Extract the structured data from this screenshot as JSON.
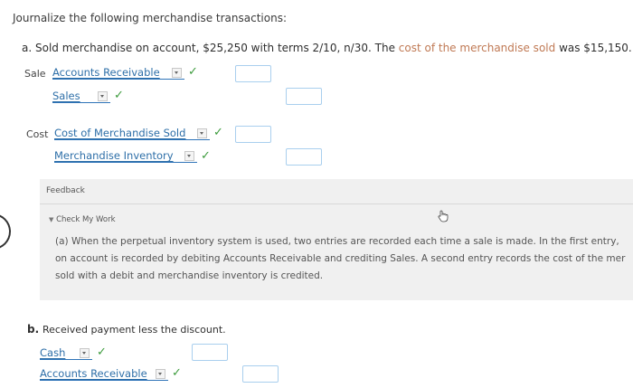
{
  "heading": "Journalize the following merchandise transactions:",
  "part_a": {
    "letter": "a.",
    "text_before": "Sold merchandise on account, $25,250 with terms 2/10, n/30. The",
    "text_highlight": "cost of the merchandise sold",
    "text_after": "was $15,150.",
    "sale_label": "Sale",
    "sale_debit": "Accounts Receivable",
    "sale_credit": "Sales",
    "cost_label": "Cost",
    "cost_debit": "Cost of Merchandise Sold",
    "cost_credit": "Merchandise Inventory"
  },
  "feedback": {
    "title": "Feedback",
    "toggle": "Check My Work",
    "line1": "(a) When the perpetual inventory system is used, two entries are recorded each time a sale is made. In the first entry,",
    "line2": "on account is recorded by debiting Accounts Receivable and crediting Sales. A second entry records the cost of the mer",
    "line3": "sold with a debit and merchandise inventory is credited."
  },
  "part_b": {
    "letter": "b.",
    "text": "Received payment less the discount.",
    "debit": "Cash",
    "credit": "Accounts Receivable"
  },
  "colors": {
    "link": "#2e6fa8",
    "check": "#3e9c3e",
    "highlight": "#c07a55",
    "feedback_bg": "#f0f0f0",
    "input_border": "#a9cfee"
  },
  "icons": {
    "check": "✓",
    "caret": "chevron-down-icon",
    "cursor": "hand-pointer-icon"
  }
}
